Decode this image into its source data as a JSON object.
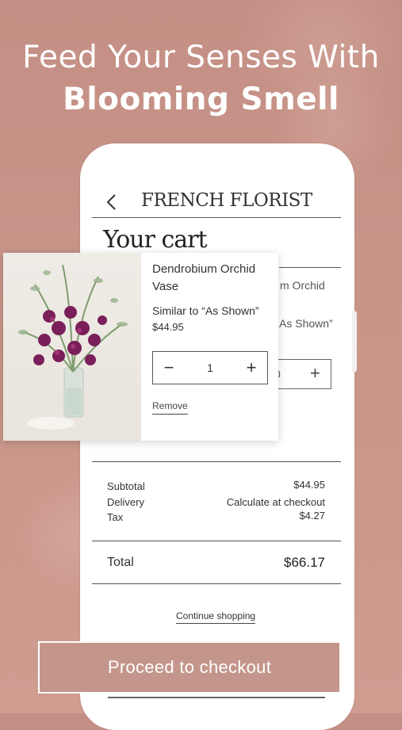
{
  "headline": {
    "line1": "Feed Your Senses With",
    "line2": "Blooming Smell"
  },
  "app": {
    "brand": "FRENCH FLORIST",
    "back_icon": "chevron-left-icon"
  },
  "cart": {
    "title": "Your cart",
    "item": {
      "name": "Dendrobium Orchid Vase",
      "variant": "Similar to “As Shown”",
      "price": "$44.95",
      "quantity": "1",
      "minus": "−",
      "plus": "+",
      "remove_label": "Remove"
    },
    "background_item": {
      "name_fragment": "m Orchid",
      "variant_fragment": "As Shown”",
      "quantity_fragment": "0",
      "plus": "+"
    },
    "summary": {
      "subtotal_label": "Subtotal",
      "subtotal_value": "$44.95",
      "delivery_label": "Delivery",
      "delivery_value": "Calculate at checkout",
      "tax_label": "Tax",
      "tax_value": "$4.27",
      "total_label": "Total",
      "total_value": "$66.17"
    },
    "continue_label": "Continue shopping",
    "checkout_label": "Proceed to checkout"
  },
  "colors": {
    "background": "#c99589",
    "button": "#c4968b",
    "orchid": "#7a1f5a"
  }
}
